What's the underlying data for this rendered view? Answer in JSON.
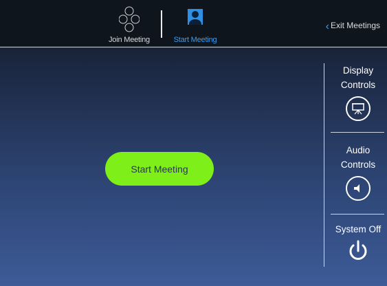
{
  "header": {
    "tabs": [
      {
        "label": "Join Meeting",
        "icon": "join-meeting-icon",
        "active": false
      },
      {
        "label": "Start Meeting",
        "icon": "person-icon",
        "active": true
      }
    ],
    "exit_label": "Exit Meetings"
  },
  "main": {
    "start_button_label": "Start Meeting"
  },
  "sidebar": {
    "display": {
      "label_line1": "Display",
      "label_line2": "Controls",
      "icon": "projector-icon"
    },
    "audio": {
      "label_line1": "Audio",
      "label_line2": "Controls",
      "icon": "speaker-icon"
    },
    "system": {
      "label": "System Off",
      "icon": "power-icon"
    }
  },
  "colors": {
    "accent": "#2f8fe6",
    "start_button": "#7fef1a"
  }
}
